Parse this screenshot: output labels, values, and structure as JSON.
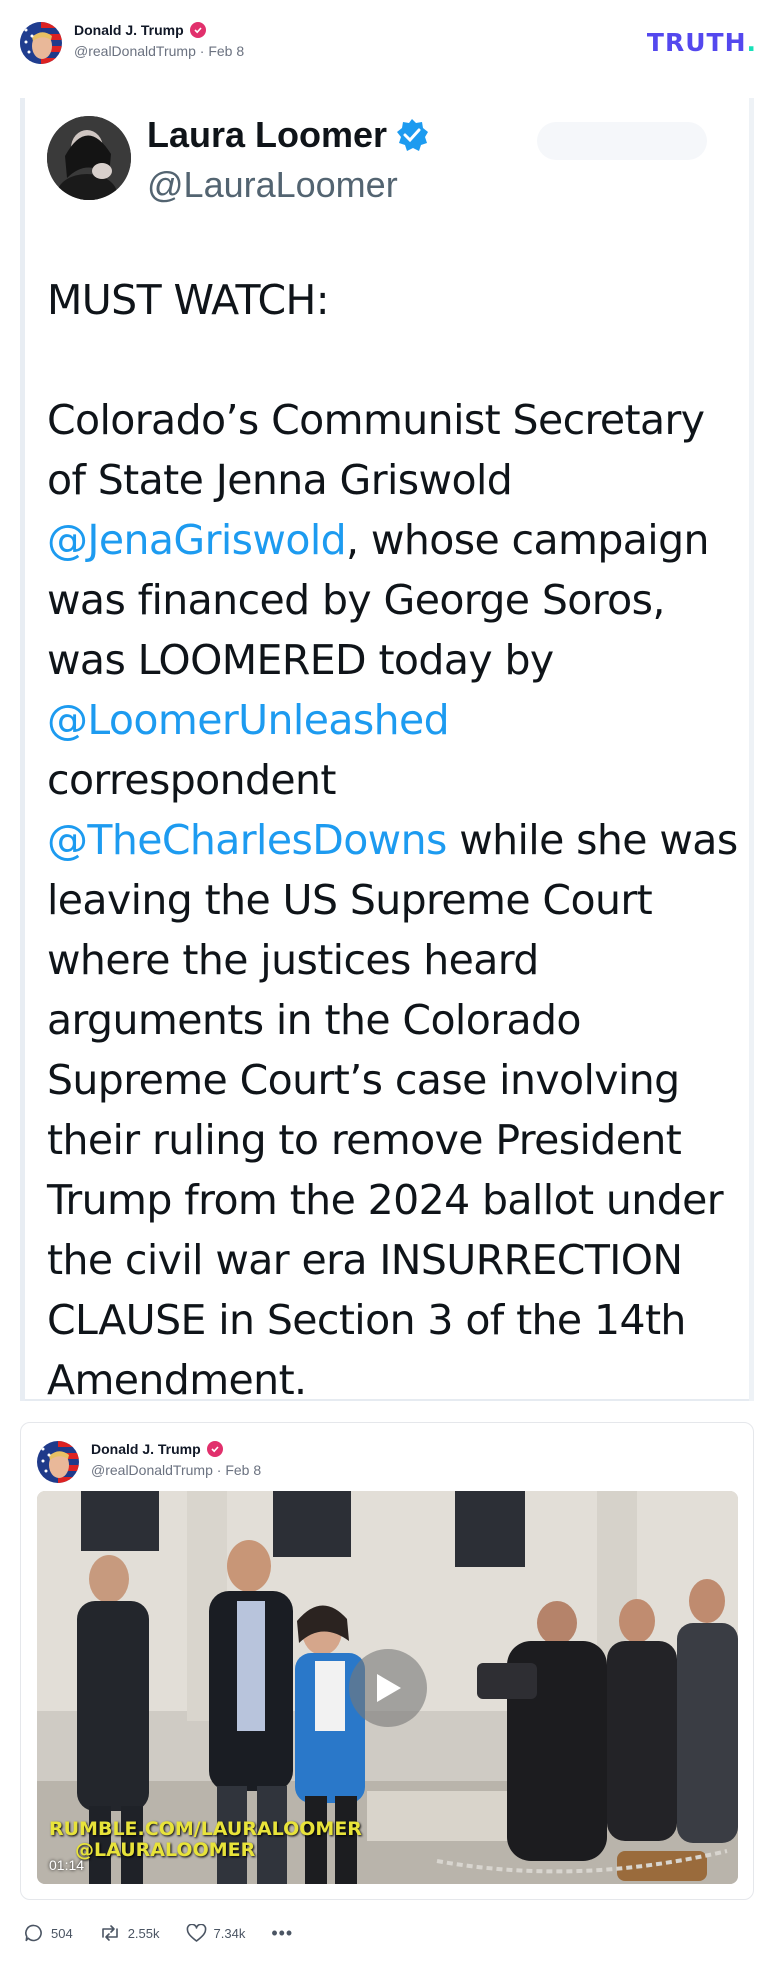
{
  "post": {
    "author_name": "Donald J. Trump",
    "handle": "@realDonaldTrump",
    "separator": "·",
    "date": "Feb 8",
    "brand_logo_text": "TRUTH",
    "brand_logo_dot": ".",
    "icons": {
      "avatar": "flag-portrait-avatar",
      "verified": "verified-badge-icon"
    }
  },
  "tweet": {
    "name": "Laura Loomer",
    "handle": "@LauraLoomer",
    "headline": "MUST WATCH:",
    "body": {
      "p1": "Colorado’s Communist Secretary of State Jenna Griswold ",
      "m1": "@JenaGriswold",
      "p2": ", whose campaign was financed by George Soros, was LOOMERED today by ",
      "m2": "@LoomerUnleashed",
      "p3": " correspondent ",
      "m3": "@TheCharlesDowns",
      "p4": " while she was leaving the US Supreme Court where the justices heard arguments in the Colorado Supreme Court’s case involving their ruling to remove President Trump from the 2024 ballot under the civil war era INSURRECTION CLAUSE in Section 3 of the 14th Amendment."
    },
    "colors": {
      "mention": "#1d9bf0",
      "verified": "#1d9bf0"
    }
  },
  "quote": {
    "author_name": "Donald J. Trump",
    "handle": "@realDonaldTrump",
    "separator": "·",
    "date": "Feb 8",
    "video": {
      "watermark_line1": "RUMBLE.COM/LAURALOOMER",
      "watermark_line2": "@LAURALOOMER",
      "duration": "01:14",
      "play_icon": "play-icon"
    }
  },
  "actions": {
    "replies": "504",
    "retruths": "2.55k",
    "likes": "7.34k",
    "more": "•••"
  },
  "colors": {
    "brand": "#5448ee",
    "brand_dot": "#17e1b8",
    "verified_pink": "#e1306c",
    "meta_text": "#6b7280"
  }
}
